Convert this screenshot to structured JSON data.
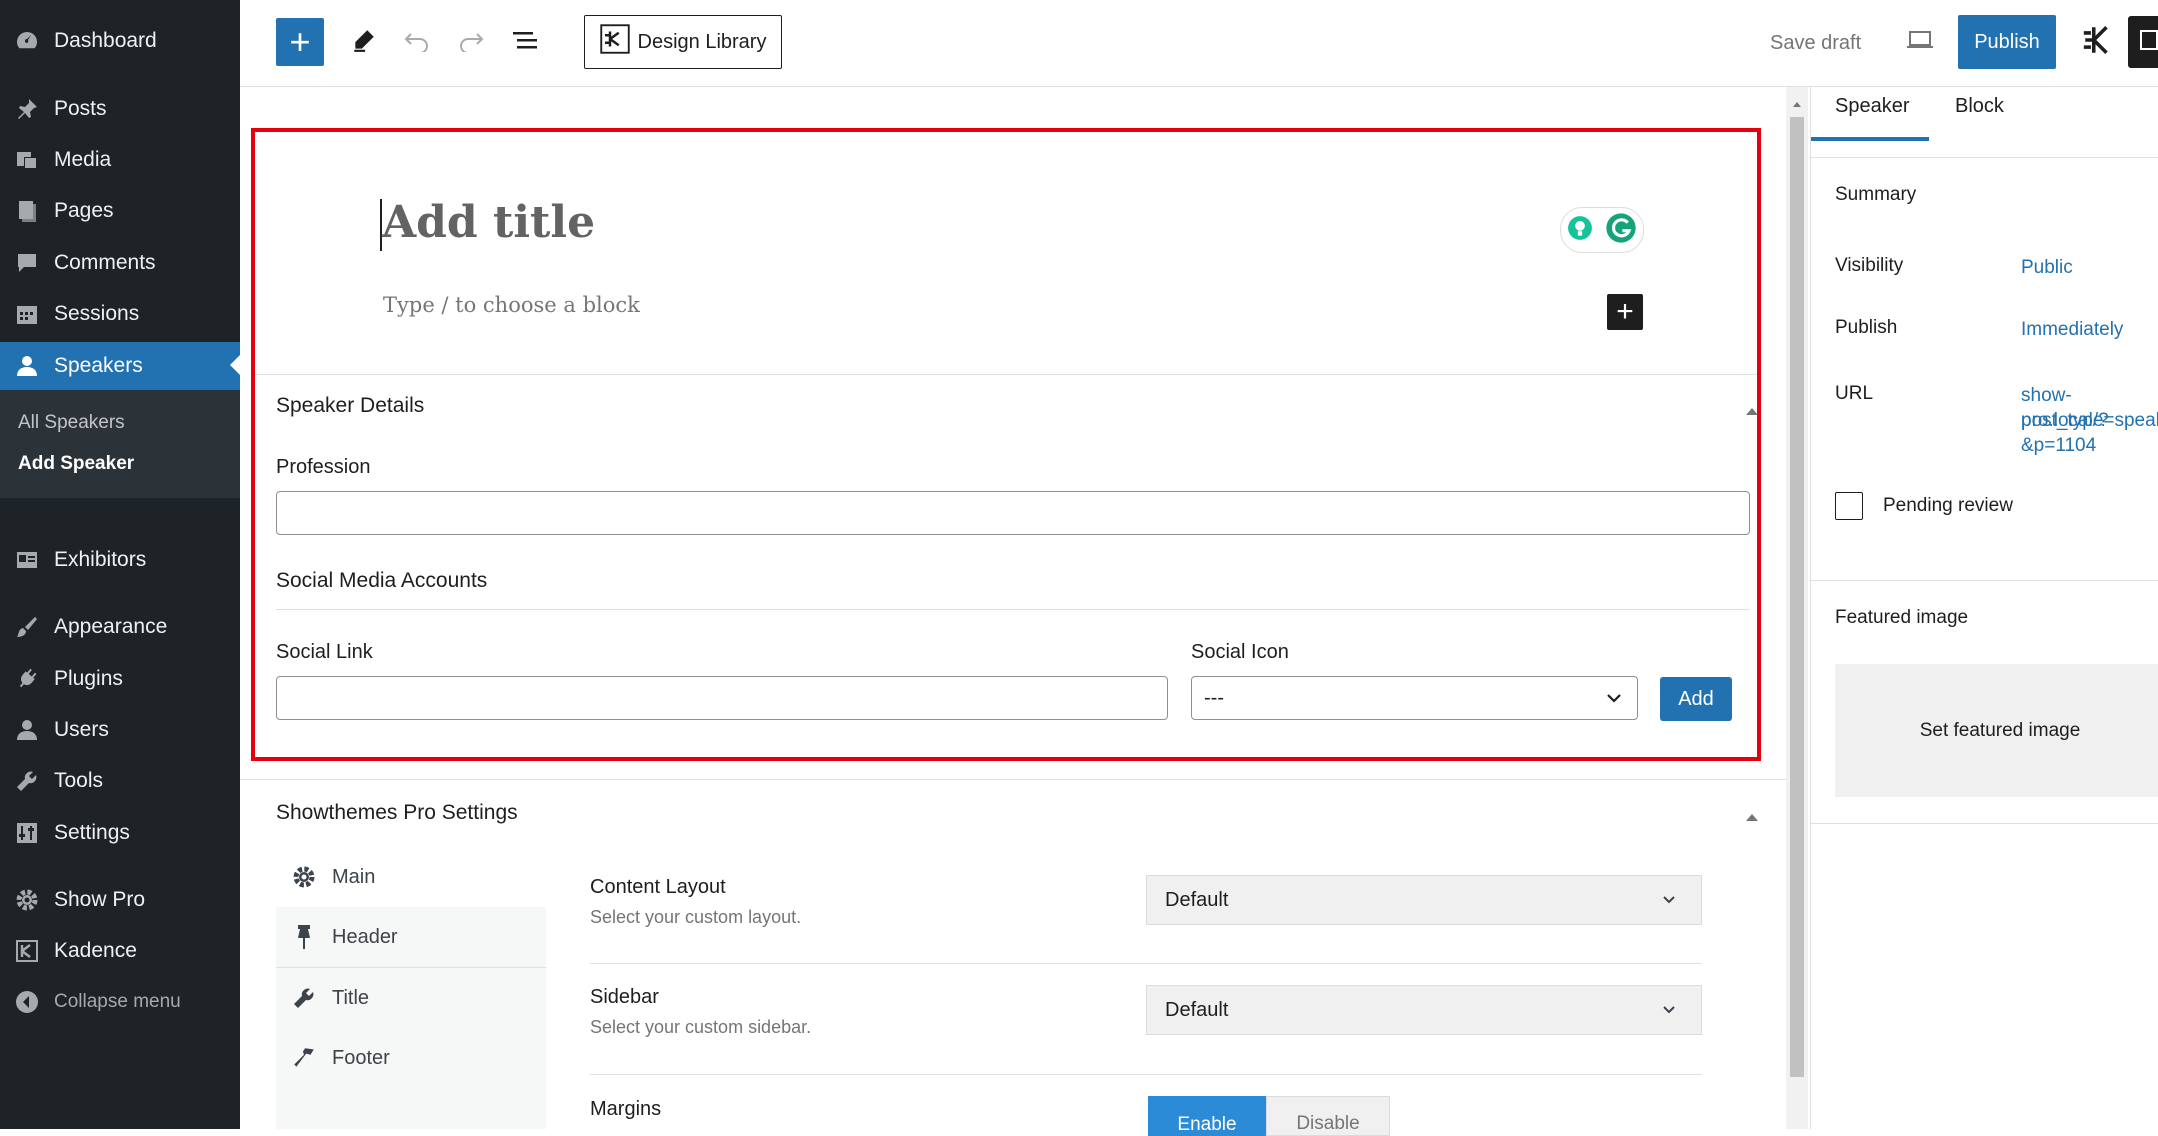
{
  "admin_menu": {
    "items": [
      {
        "label": "Dashboard",
        "icon": "dashboard-icon"
      },
      {
        "label": "Posts",
        "icon": "pin-icon"
      },
      {
        "label": "Media",
        "icon": "media-icon"
      },
      {
        "label": "Pages",
        "icon": "page-icon"
      },
      {
        "label": "Comments",
        "icon": "comment-icon"
      },
      {
        "label": "Sessions",
        "icon": "calendar-icon"
      },
      {
        "label": "Speakers",
        "icon": "person-icon"
      },
      {
        "label": "Exhibitors",
        "icon": "id-card-icon"
      },
      {
        "label": "Appearance",
        "icon": "paintbrush-icon"
      },
      {
        "label": "Plugins",
        "icon": "plug-icon"
      },
      {
        "label": "Users",
        "icon": "user-icon"
      },
      {
        "label": "Tools",
        "icon": "wrench-icon"
      },
      {
        "label": "Settings",
        "icon": "sliders-icon"
      },
      {
        "label": "Show Pro",
        "icon": "gear-icon"
      },
      {
        "label": "Kadence",
        "icon": "kadence-icon"
      },
      {
        "label": "Collapse menu",
        "icon": "collapse-icon"
      }
    ],
    "submenu": [
      "All Speakers",
      "Add Speaker"
    ]
  },
  "toolbar": {
    "design_library": "Design Library",
    "save_draft": "Save draft",
    "publish": "Publish"
  },
  "editor": {
    "title_placeholder": "Add title",
    "block_placeholder": "Type / to choose a block"
  },
  "speaker_details": {
    "heading": "Speaker Details",
    "profession_label": "Profession",
    "profession_value": "",
    "social_heading": "Social Media Accounts",
    "social_link_label": "Social Link",
    "social_link_value": "",
    "social_icon_label": "Social Icon",
    "social_icon_value": "---",
    "add_label": "Add"
  },
  "showthemes": {
    "heading": "Showthemes Pro Settings",
    "tabs": [
      "Main",
      "Header",
      "Title",
      "Footer"
    ],
    "content_layout_label": "Content Layout",
    "content_layout_desc": "Select your custom layout.",
    "content_layout_value": "Default",
    "sidebar_label": "Sidebar",
    "sidebar_desc": "Select your custom sidebar.",
    "sidebar_value": "Default",
    "margins_label": "Margins",
    "enable": "Enable",
    "disable": "Disable"
  },
  "sidebar": {
    "tab_speaker": "Speaker",
    "tab_block": "Block",
    "summary": "Summary",
    "visibility_label": "Visibility",
    "visibility_value": "Public",
    "publish_label": "Publish",
    "publish_value": "Immediately",
    "url_label": "URL",
    "url_line1": "show-pro.local/?",
    "url_line2": "post_type=speak",
    "url_line3": "&p=1104",
    "pending_review": "Pending review",
    "featured_image": "Featured image",
    "set_featured_image": "Set featured image"
  },
  "colors": {
    "accent": "#2271b1",
    "admin_menu_bg": "#1d2327",
    "highlight_border": "#e5000e"
  }
}
